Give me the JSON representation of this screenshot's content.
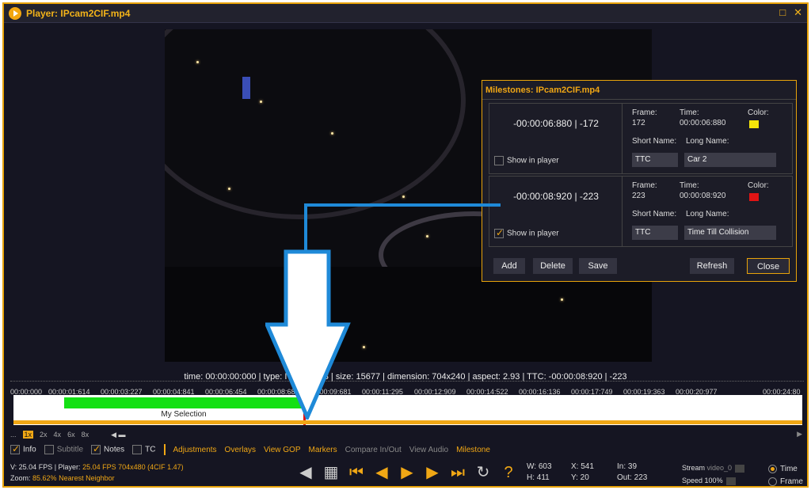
{
  "window": {
    "title": "Player: IPcam2CIF.mp4",
    "maximize_icon": "□",
    "close_icon": "✕"
  },
  "info_line": "time: 00:00:00:000 | type: I | frame 48 | size: 15677 | dimension: 704x240 | aspect: 2.93 | TTC: -00:00:08:920 | -223",
  "timeline": {
    "ticks": [
      "00:00:000",
      "00:00:01:614",
      "00:00:03:227",
      "00:00:04:841",
      "00:00:06:454",
      "00:00:08:68",
      "00:00:09:681",
      "00:00:11:295",
      "00:00:12:909",
      "00:00:14:522",
      "00:00:16:136",
      "00:00:17:749",
      "00:00:19:363",
      "00:00:20:977",
      "00:00:24:80"
    ],
    "selection_label": "My Selection"
  },
  "speed": {
    "items": [
      "...",
      "1x",
      "2x",
      "4x",
      "6x",
      "8x"
    ],
    "active": "1x"
  },
  "toolbar": {
    "info": "Info",
    "subtitle": "Subtitle",
    "notes": "Notes",
    "tc": "TC",
    "adjustments": "Adjustments",
    "overlays": "Overlays",
    "view_gop": "View GOP",
    "markers": "Markers",
    "compare": "Compare In/Out",
    "view_audio": "View Audio",
    "milestone": "Milestone"
  },
  "status": {
    "line1a": "V: 25.04 FPS | Player:",
    "line1b": "25.04 FPS",
    "line1c": "704x480 (4CIF 1.47)",
    "line2a": "Zoom:",
    "line2b": "85.62%",
    "line2c": "Nearest Neighbor"
  },
  "stats": {
    "w": "W: 603",
    "x": "X: 541",
    "in": "In: 39",
    "h": "H: 411",
    "y": "Y: 20",
    "out": "Out: 223"
  },
  "stream": {
    "label": "Stream",
    "value": "video_0",
    "speed_label": "Speed",
    "speed_value": "100%"
  },
  "mode": {
    "time": "Time",
    "frame": "Frame"
  },
  "milestones": {
    "title": "Milestones: IPcam2CIF.mp4",
    "labels": {
      "frame": "Frame:",
      "time": "Time:",
      "color": "Color:",
      "short": "Short Name:",
      "long": "Long Name:",
      "show": "Show in player"
    },
    "items": [
      {
        "display": "-00:00:06:880 | -172",
        "frame": "172",
        "time": "00:00:06:880",
        "color": "#f5e60a",
        "short": "TTC",
        "long": "Car 2",
        "show": false
      },
      {
        "display": "-00:00:08:920 | -223",
        "frame": "223",
        "time": "00:00:08:920",
        "color": "#e01414",
        "short": "TTC",
        "long": "Time Till Collision",
        "show": true
      }
    ],
    "buttons": {
      "add": "Add",
      "delete": "Delete",
      "save": "Save",
      "refresh": "Refresh",
      "close": "Close"
    }
  }
}
